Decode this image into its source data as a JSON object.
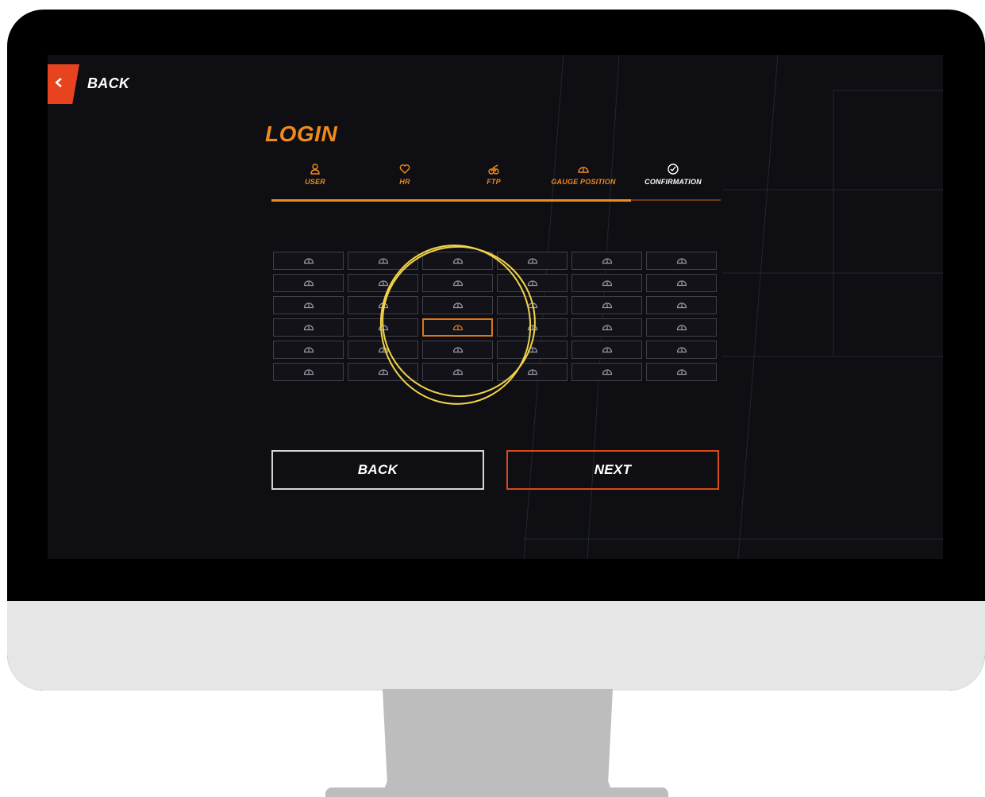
{
  "nav": {
    "back_label": "BACK",
    "back_icon": "chevron-left-icon"
  },
  "page": {
    "title": "LOGIN"
  },
  "steps": [
    {
      "label": "USER",
      "icon": "user-icon",
      "state": "done"
    },
    {
      "label": "HR",
      "icon": "heart-icon",
      "state": "done"
    },
    {
      "label": "FTP",
      "icon": "bike-icon",
      "state": "done"
    },
    {
      "label": "GAUGE POSITION",
      "icon": "gauge-icon",
      "state": "done"
    },
    {
      "label": "CONFIRMATION",
      "icon": "check-circle-icon",
      "state": "current"
    }
  ],
  "progress": {
    "completed_steps": 4,
    "total_steps": 5
  },
  "gauge_grid": {
    "rows": 6,
    "columns": 6,
    "selected_row": 4,
    "selected_column": 3,
    "cell_icon": "gauge-icon"
  },
  "buttons": {
    "back_label": "BACK",
    "next_label": "NEXT"
  },
  "colors": {
    "accent": "#f08a1c",
    "danger": "#e8431f",
    "highlight": "#f2d34a",
    "screen_bg": "#0f0e13"
  }
}
